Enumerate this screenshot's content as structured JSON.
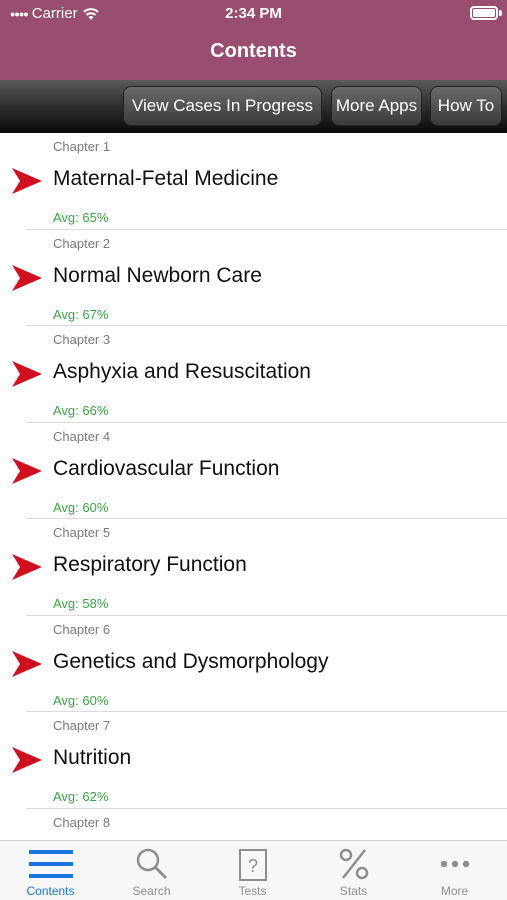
{
  "status": {
    "carrier": "Carrier",
    "time": "2:34 PM"
  },
  "header": {
    "title": "Contents"
  },
  "toolbar": {
    "cases": "View Cases In Progress",
    "apps": "More Apps",
    "howto": "How To"
  },
  "chapters": [
    {
      "chapter": "Chapter 1",
      "title": "Maternal-Fetal Medicine",
      "avg": "Avg: 65%"
    },
    {
      "chapter": "Chapter 2",
      "title": "Normal Newborn Care",
      "avg": "Avg: 67%"
    },
    {
      "chapter": "Chapter 3",
      "title": "Asphyxia and Resuscitation",
      "avg": "Avg: 66%"
    },
    {
      "chapter": "Chapter 4",
      "title": "Cardiovascular Function",
      "avg": "Avg: 60%"
    },
    {
      "chapter": "Chapter 5",
      "title": "Respiratory Function",
      "avg": "Avg: 58%"
    },
    {
      "chapter": "Chapter 6",
      "title": "Genetics and Dysmorphology",
      "avg": "Avg: 60%"
    },
    {
      "chapter": "Chapter 7",
      "title": "Nutrition",
      "avg": "Avg: 62%"
    },
    {
      "chapter": "Chapter 8",
      "title": "",
      "avg": ""
    }
  ],
  "tabs": [
    {
      "label": "Contents",
      "icon": "list-icon"
    },
    {
      "label": "Search",
      "icon": "search-icon"
    },
    {
      "label": "Tests",
      "icon": "tests-icon"
    },
    {
      "label": "Stats",
      "icon": "percent-icon"
    },
    {
      "label": "More",
      "icon": "more-icon"
    }
  ],
  "colors": {
    "header": "#9a4e6f",
    "avg": "#3aa544",
    "arrow": "#d0101f",
    "active_tab": "#1977e3"
  }
}
